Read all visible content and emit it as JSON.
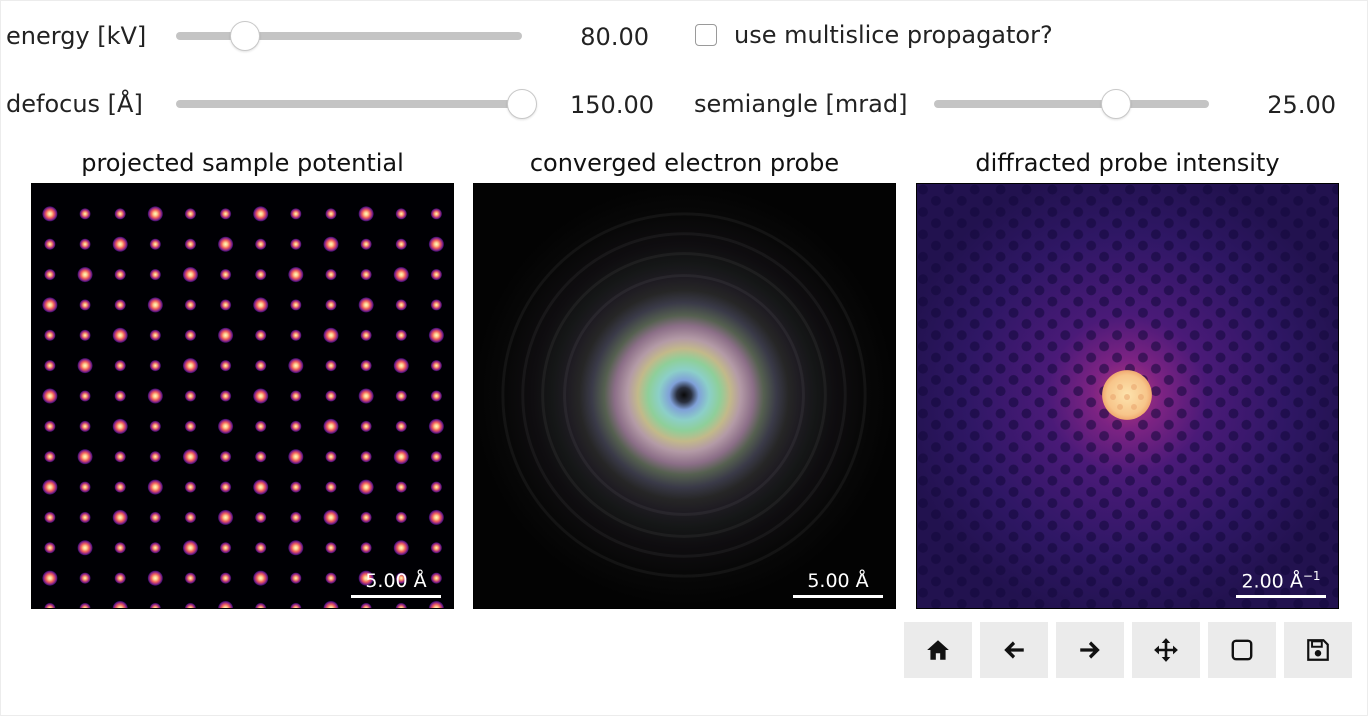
{
  "controls": {
    "energy": {
      "label": "energy [kV]",
      "value": "80.00",
      "level": 0.2
    },
    "multislice": {
      "label": "use multislice propagator?",
      "checked": false
    },
    "defocus": {
      "label": "defocus [Å]",
      "value": "150.00",
      "level": 1.0
    },
    "semiangle": {
      "label": "semiangle [mrad]",
      "value": "25.00",
      "level": 0.66
    }
  },
  "panels": [
    {
      "title": "projected sample potential",
      "scalebar": "5.00 Å",
      "colormap": "magma",
      "image": "atomic-lattice-image"
    },
    {
      "title": "converged electron probe",
      "scalebar": "5.00 Å",
      "colormap": "complex-hsv",
      "image": "probe-rings-image"
    },
    {
      "title": "diffracted probe intensity",
      "scalebar": "2.00 Å",
      "scalebar_sup": "−1",
      "colormap": "magma",
      "image": "diffraction-pattern-image"
    }
  ],
  "toolbar": [
    {
      "name": "home-button",
      "icon": "home-icon"
    },
    {
      "name": "back-button",
      "icon": "arrow-left-icon"
    },
    {
      "name": "forward-button",
      "icon": "arrow-right-icon"
    },
    {
      "name": "pan-button",
      "icon": "move-icon"
    },
    {
      "name": "zoom-rect-button",
      "icon": "square-icon"
    },
    {
      "name": "save-button",
      "icon": "floppy-disk-icon"
    }
  ],
  "colors": {
    "magma_background": "#000004",
    "magma_atom": "#fcfdbf",
    "diffraction_background": "#2a1560",
    "disk": "#f7c58a"
  }
}
